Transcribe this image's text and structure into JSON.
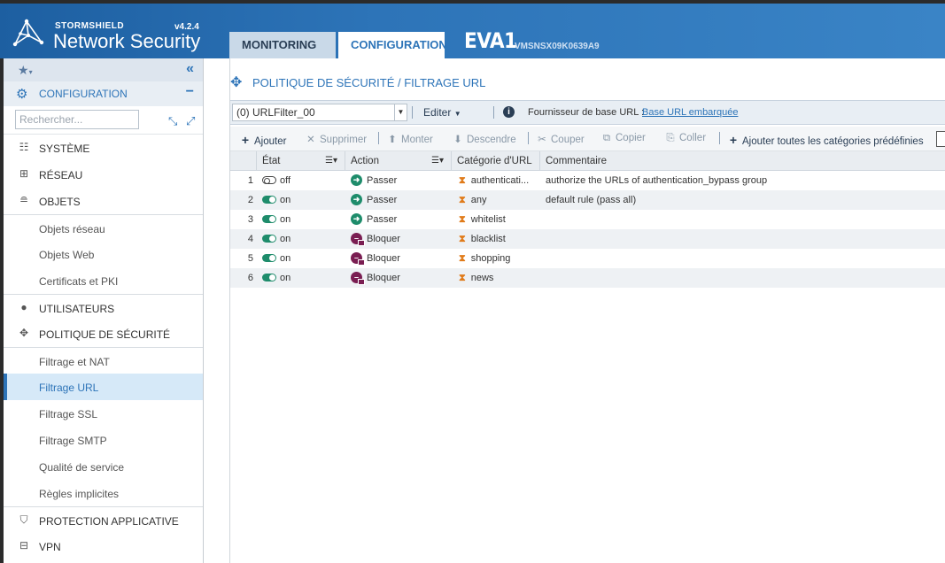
{
  "header": {
    "brand_top": "STORMSHIELD",
    "brand_main": "Network Security",
    "version": "v4.2.4",
    "tabs": [
      {
        "label": "MONITORING"
      },
      {
        "label": "CONFIGURATION"
      }
    ],
    "device_name": "EVA1",
    "serial": "VMSNSX09K0639A9",
    "color": "#2d74b8"
  },
  "sidebar": {
    "section_label": "CONFIGURATION",
    "search_placeholder": "Rechercher...",
    "items": [
      {
        "label": "SYSTÈME",
        "icon": "sliders-icon"
      },
      {
        "label": "RÉSEAU",
        "icon": "network-icon"
      },
      {
        "label": "OBJETS",
        "icon": "database-icon"
      },
      {
        "label": "Objets réseau"
      },
      {
        "label": "Objets Web"
      },
      {
        "label": "Certificats et PKI"
      },
      {
        "label": "UTILISATEURS",
        "icon": "user-icon"
      },
      {
        "label": "POLITIQUE DE SÉCURITÉ",
        "icon": "move-arrows-icon"
      },
      {
        "label": "Filtrage et NAT"
      },
      {
        "label": "Filtrage URL",
        "active": true
      },
      {
        "label": "Filtrage SSL"
      },
      {
        "label": "Filtrage SMTP"
      },
      {
        "label": "Qualité de service"
      },
      {
        "label": "Règles implicites"
      },
      {
        "label": "PROTECTION APPLICATIVE",
        "icon": "shield-icon"
      },
      {
        "label": "VPN",
        "icon": "vpn-icon"
      }
    ]
  },
  "main": {
    "title": "POLITIQUE DE SÉCURITÉ / FILTRAGE URL",
    "filter_selected": "(0) URLFilter_00",
    "edit_label": "Editer",
    "provider_label": "Fournisseur de base URL :",
    "provider_link": "Base URL embarquée",
    "toolbar": [
      {
        "label": "Ajouter",
        "icon": "plus-icon"
      },
      {
        "label": "Supprimer",
        "icon": "x-icon"
      },
      {
        "label": "Monter",
        "icon": "arrow-up-icon"
      },
      {
        "label": "Descendre",
        "icon": "arrow-down-icon"
      },
      {
        "label": "Couper",
        "icon": "cut-icon"
      },
      {
        "label": "Copier",
        "icon": "copy-icon"
      },
      {
        "label": "Coller",
        "icon": "paste-icon"
      },
      {
        "label": "Ajouter toutes les catégories prédéfinies",
        "icon": "plus-icon"
      }
    ],
    "columns": [
      "État",
      "Action",
      "Catégorie d'URL",
      "Commentaire"
    ],
    "rows": [
      {
        "num": "1",
        "state": "off",
        "action": "Passer",
        "category": "authenticati...",
        "comment": "authorize the URLs of authentication_bypass group"
      },
      {
        "num": "2",
        "state": "on",
        "action": "Passer",
        "category": "any",
        "comment": "default rule (pass all)"
      },
      {
        "num": "3",
        "state": "on",
        "action": "Passer",
        "category": "whitelist",
        "comment": ""
      },
      {
        "num": "4",
        "state": "on",
        "action": "Bloquer",
        "category": "blacklist",
        "comment": ""
      },
      {
        "num": "5",
        "state": "on",
        "action": "Bloquer",
        "category": "shopping",
        "comment": ""
      },
      {
        "num": "6",
        "state": "on",
        "action": "Bloquer",
        "category": "news",
        "comment": ""
      }
    ]
  }
}
